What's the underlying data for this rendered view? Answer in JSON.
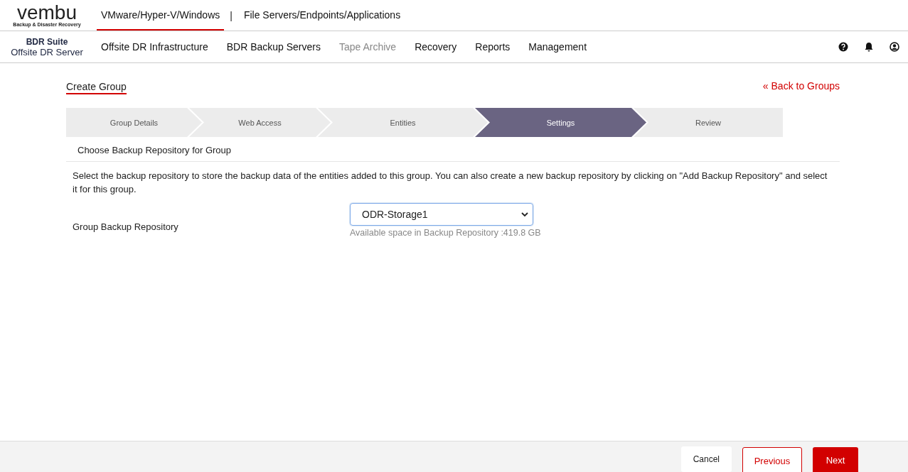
{
  "logo": {
    "name": "vembu",
    "tagline": "Backup & Disaster Recovery"
  },
  "product_tabs": [
    {
      "label": "VMware/Hyper-V/Windows",
      "selected": true
    },
    {
      "label": "File Servers/Endpoints/Applications",
      "selected": false
    }
  ],
  "product_separator": "|",
  "suite": {
    "title": "BDR Suite",
    "subtitle": "Offsite DR Server"
  },
  "nav": [
    {
      "label": "Offsite DR Infrastructure",
      "disabled": false
    },
    {
      "label": "BDR Backup Servers",
      "disabled": false
    },
    {
      "label": "Tape Archive",
      "disabled": true
    },
    {
      "label": "Recovery",
      "disabled": false
    },
    {
      "label": "Reports",
      "disabled": false
    },
    {
      "label": "Management",
      "disabled": false
    }
  ],
  "page_title": "Create Group",
  "back_link": "« Back to Groups",
  "steps": [
    {
      "label": "Group Details",
      "selected": false
    },
    {
      "label": "Web Access",
      "selected": false
    },
    {
      "label": "Entities",
      "selected": false
    },
    {
      "label": "Settings",
      "selected": true
    },
    {
      "label": "Review",
      "selected": false
    }
  ],
  "section_title": "Choose Backup Repository for Group",
  "description": "Select the backup repository to store the backup data of the entities added to this group. You can also create a new backup repository by clicking on \"Add Backup Repository\" and select it for this group.",
  "repository": {
    "label": "Group Backup Repository",
    "value": "ODR-Storage1",
    "hint": "Available space in Backup Repository :419.8 GB"
  },
  "buttons": [
    {
      "label": "Cancel",
      "kind": "plain"
    },
    {
      "label": "Previous",
      "kind": "outline"
    },
    {
      "label": "Next",
      "kind": "primary"
    }
  ]
}
